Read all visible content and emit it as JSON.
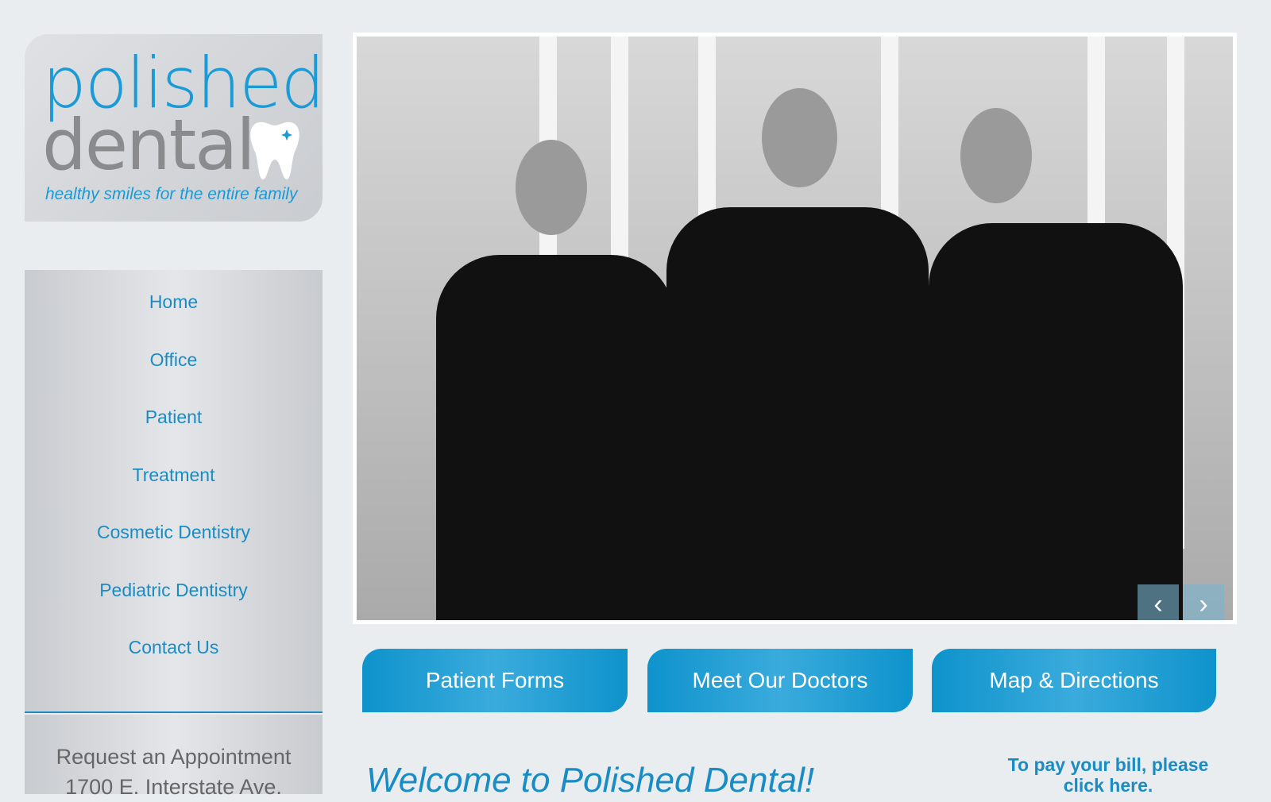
{
  "logo": {
    "line1": "polished",
    "line2": "dental",
    "tagline": "healthy smiles for the entire family"
  },
  "nav": {
    "items": [
      {
        "label": "Home"
      },
      {
        "label": "Office"
      },
      {
        "label": "Patient"
      },
      {
        "label": "Treatment"
      },
      {
        "label": "Cosmetic Dentistry"
      },
      {
        "label": "Pediatric Dentistry"
      },
      {
        "label": "Contact Us"
      }
    ]
  },
  "appointment": {
    "title": "Request an Appointment",
    "address": "1700 E. Interstate Ave."
  },
  "slider": {
    "prev_icon": "chevron-left-icon",
    "next_icon": "chevron-right-icon",
    "prev": "‹",
    "next": "›"
  },
  "buttons": [
    {
      "label": "Patient Forms"
    },
    {
      "label": "Meet Our Doctors"
    },
    {
      "label": "Map & Directions"
    }
  ],
  "welcome": "Welcome to Polished Dental!",
  "bill": {
    "line1": "To pay your bill, please",
    "line2": "click here."
  },
  "colors": {
    "accent": "#1a8cc4",
    "background": "#e9edef"
  }
}
